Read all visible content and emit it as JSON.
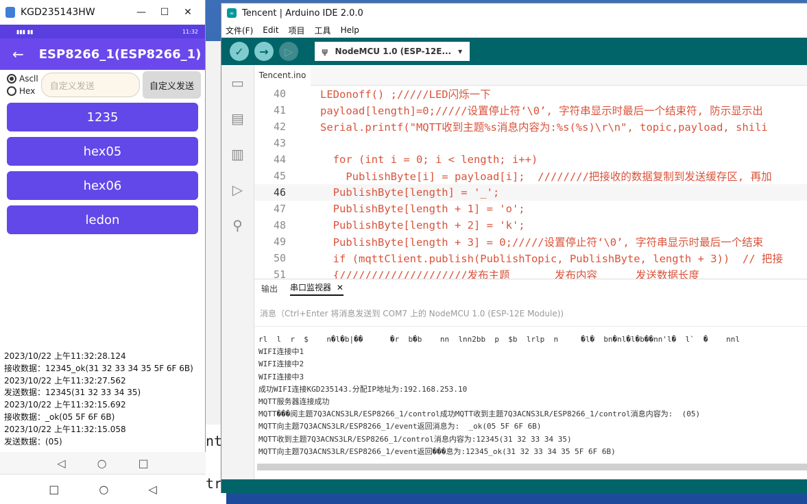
{
  "phone": {
    "window_title": "KGD235143HW",
    "status_time": "11:32",
    "app_title": "ESP8266_1(ESP8266_1)",
    "radio_ascii": "Ascll",
    "radio_hex": "Hex",
    "custom_placeholder": "自定义发送",
    "custom_send_label": "自定义发送",
    "buttons": [
      "1235",
      "hex05",
      "hex06",
      "ledon"
    ],
    "log": [
      "2023/10/22 上午11:32:28.124",
      "接收数据：12345_ok(31 32 33 34 35 5F 6F 6B)",
      "2023/10/22 上午11:32:27.562",
      "发送数据：12345(31 32 33 34 35)",
      "2023/10/22 上午11:32:15.692",
      "接收数据：_ok(05 5F 6F 6B)",
      "2023/10/22 上午11:32:15.058",
      "发送数据：(05)"
    ]
  },
  "ide": {
    "window_title": "Tencent | Arduino IDE 2.0.0",
    "menu": [
      "文件(F)",
      "Edit",
      "项目",
      "工具",
      "Help"
    ],
    "board": "NodeMCU 1.0 (ESP-12E...",
    "file_tab": "Tencent.ino",
    "code_lines": [
      {
        "n": "40",
        "text": "LEDonoff() ;/////LED闪烁一下"
      },
      {
        "n": "41",
        "text": "payload[length]=0;/////设置停止符‘\\0’, 字符串显示时最后一个结束符, 防示显示出"
      },
      {
        "n": "42",
        "text": "Serial.printf(\"MQTT收到主题%s消息内容为:%s(%s)\\r\\n\", topic,payload, shili"
      },
      {
        "n": "43",
        "text": ""
      },
      {
        "n": "44",
        "text": "  for (int i = 0; i < length; i++)"
      },
      {
        "n": "45",
        "text": "    PublishByte[i] = payload[i];  ////////把接收的数据复制到发送缓存区, 再加"
      },
      {
        "n": "46",
        "text": "  PublishByte[length] = '_';"
      },
      {
        "n": "47",
        "text": "  PublishByte[length + 1] = 'o';"
      },
      {
        "n": "48",
        "text": "  PublishByte[length + 2] = 'k';"
      },
      {
        "n": "49",
        "text": "  PublishByte[length + 3] = 0;/////设置停止符‘\\0’, 字符串显示时最后一个结束"
      },
      {
        "n": "50",
        "text": "  if (mqttClient.publish(PublishTopic, PublishByte, length + 3))  // 把接"
      },
      {
        "n": "51",
        "text": "  {////////////////////发布主题       发布内容      发送数据长度"
      }
    ],
    "output_tab": "输出",
    "monitor_tab": "串口监视器",
    "message_placeholder": "消息（Ctrl+Enter 将消息发送到 COM7 上的 NodeMCU 1.0 (ESP-12E Module))",
    "monitor_lines": [
      "rl  l  r  $    n�l�b|��      �r  b�b    nn  lnn2bb  p  $b  lrlp  n     �l�  bn�nl�l�b��nn'l�  l`  �    nnl",
      "WIFI连接中1",
      "WIFI连接中2",
      "WIFI连接中3",
      "成功WIFI连接KGD235143.分配IP地址为:192.168.253.10",
      "MQTT服务器连接成功",
      "MQTT���阅主题7Q3ACNS3LR/ESP8266_1/control成功MQTT收到主题7Q3ACNS3LR/ESP8266_1/control消息内容为:  (05)",
      "MQTT向主题7Q3ACNS3LR/ESP8266_1/event返回消息为:  _ok(05 5F 6F 6B)",
      "MQTT收到主题7Q3ACNS3LR/ESP8266_1/control消息内容为:12345(31 32 33 34 35)",
      "MQTT向主题7Q3ACNS3LR/ESP8266_1/event返回���息为:12345_ok(31 32 33 34 35 5F 6F 6B)"
    ]
  },
  "background": {
    "text_a": "nt",
    "text_b": "tr"
  },
  "colors": {
    "phone_accent": "#6248e8",
    "ide_teal": "#006468",
    "code_orange": "#d9533a"
  }
}
